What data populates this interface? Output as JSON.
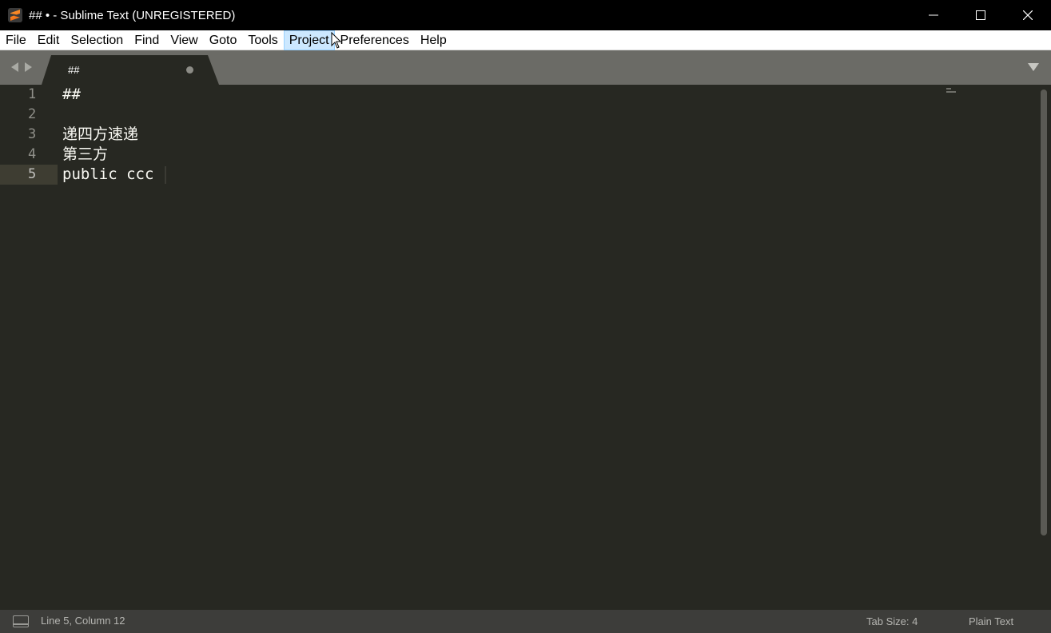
{
  "window": {
    "title": "## • - Sublime Text (UNREGISTERED)",
    "controls": [
      "minimize",
      "maximize",
      "close"
    ]
  },
  "menu": {
    "items": [
      "File",
      "Edit",
      "Selection",
      "Find",
      "View",
      "Goto",
      "Tools",
      "Project",
      "Preferences",
      "Help"
    ],
    "hovered": "Project"
  },
  "tabs": [
    {
      "label": "##",
      "dirty": true,
      "active": true
    }
  ],
  "editor": {
    "lines": [
      {
        "number": "1",
        "text": "##"
      },
      {
        "number": "2",
        "text": ""
      },
      {
        "number": "3",
        "text": "递四方速递"
      },
      {
        "number": "4",
        "text": "第三方"
      },
      {
        "number": "5",
        "text": "public ccc"
      }
    ],
    "current_line": 5
  },
  "status": {
    "position": "Line 5, Column 12",
    "tab_size": "Tab Size: 4",
    "syntax": "Plain Text"
  },
  "colors": {
    "editor_bg": "#272822",
    "text": "#f8f8f2",
    "tabbar_bg": "#6b6b66",
    "statusbar_bg": "#3d3d3a",
    "menu_hover": "#cce8ff"
  }
}
